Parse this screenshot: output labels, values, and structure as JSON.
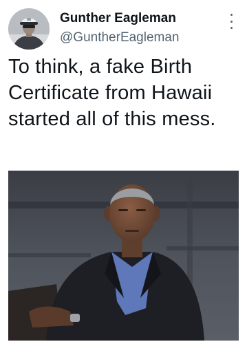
{
  "tweet": {
    "display_name": "Gunther Eagleman",
    "handle": "@GuntherEagleman",
    "text": "To think, a fake Birth Certificate from Hawaii started all of this mess.",
    "more_icon": "more-vertical-icon",
    "media": "photo-man-dark-suit-blue-shirt"
  }
}
